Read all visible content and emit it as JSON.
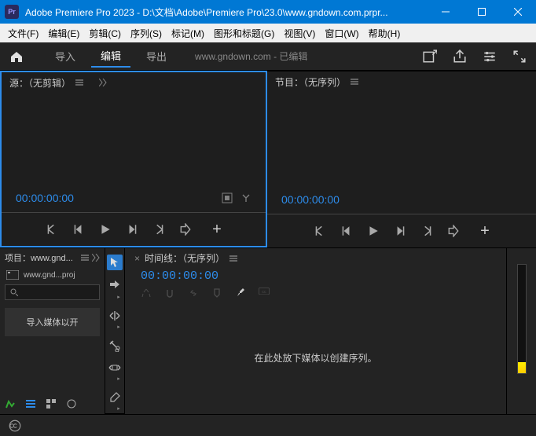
{
  "titlebar": {
    "app_icon_text": "Pr",
    "title": "Adobe Premiere Pro 2023 - D:\\文档\\Adobe\\Premiere Pro\\23.0\\www.gndown.com.prpr..."
  },
  "menubar": {
    "items": [
      "文件(F)",
      "编辑(E)",
      "剪辑(C)",
      "序列(S)",
      "标记(M)",
      "图形和标题(G)",
      "视图(V)",
      "窗口(W)",
      "帮助(H)"
    ]
  },
  "toptabs": {
    "tabs": [
      {
        "label": "导入",
        "active": false
      },
      {
        "label": "编辑",
        "active": true
      },
      {
        "label": "导出",
        "active": false
      }
    ],
    "document": "www.gndown.com - 已编辑"
  },
  "source_panel": {
    "title": "源：（无剪辑）",
    "timecode": "00:00:00:00"
  },
  "program_panel": {
    "title": "节目：（无序列）",
    "timecode": "00:00:00:00"
  },
  "project_panel": {
    "title": "项目：www.gnd...",
    "bin_name": "www.gnd...proj",
    "search_placeholder": "",
    "import_hint": "导入媒体以开"
  },
  "timeline_panel": {
    "title": "时间线：（无序列）",
    "timecode": "00:00:00:00",
    "drop_hint": "在此处放下媒体以创建序列。"
  }
}
